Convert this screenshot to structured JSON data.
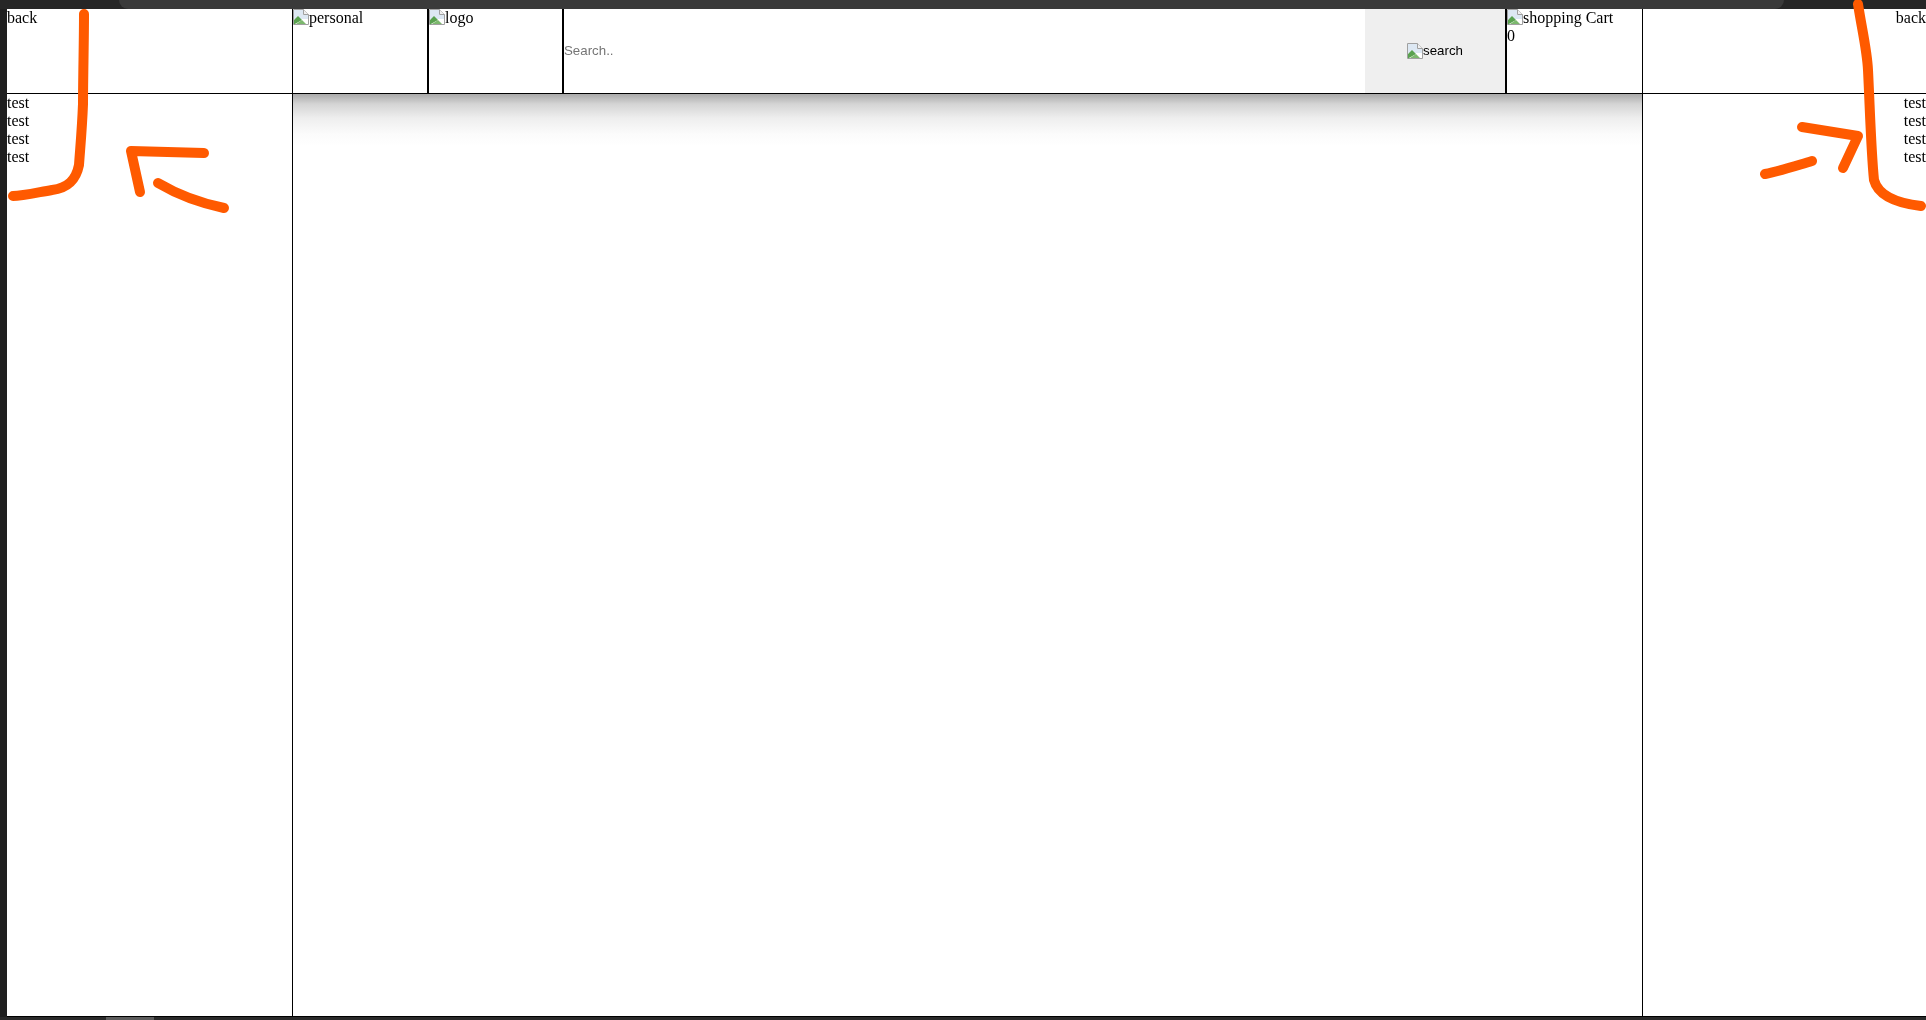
{
  "header": {
    "back_left": "back",
    "personal_image": "personal",
    "logo_image": "logo",
    "search": {
      "placeholder": "Search..",
      "button": "search"
    },
    "cart": {
      "label": "shopping Cart",
      "count": "0"
    },
    "back_right": "back"
  },
  "left_sidebar": {
    "items": [
      "test",
      "test",
      "test",
      "test"
    ]
  },
  "right_sidebar": {
    "items": [
      "test",
      "test",
      "test",
      "test"
    ]
  }
}
